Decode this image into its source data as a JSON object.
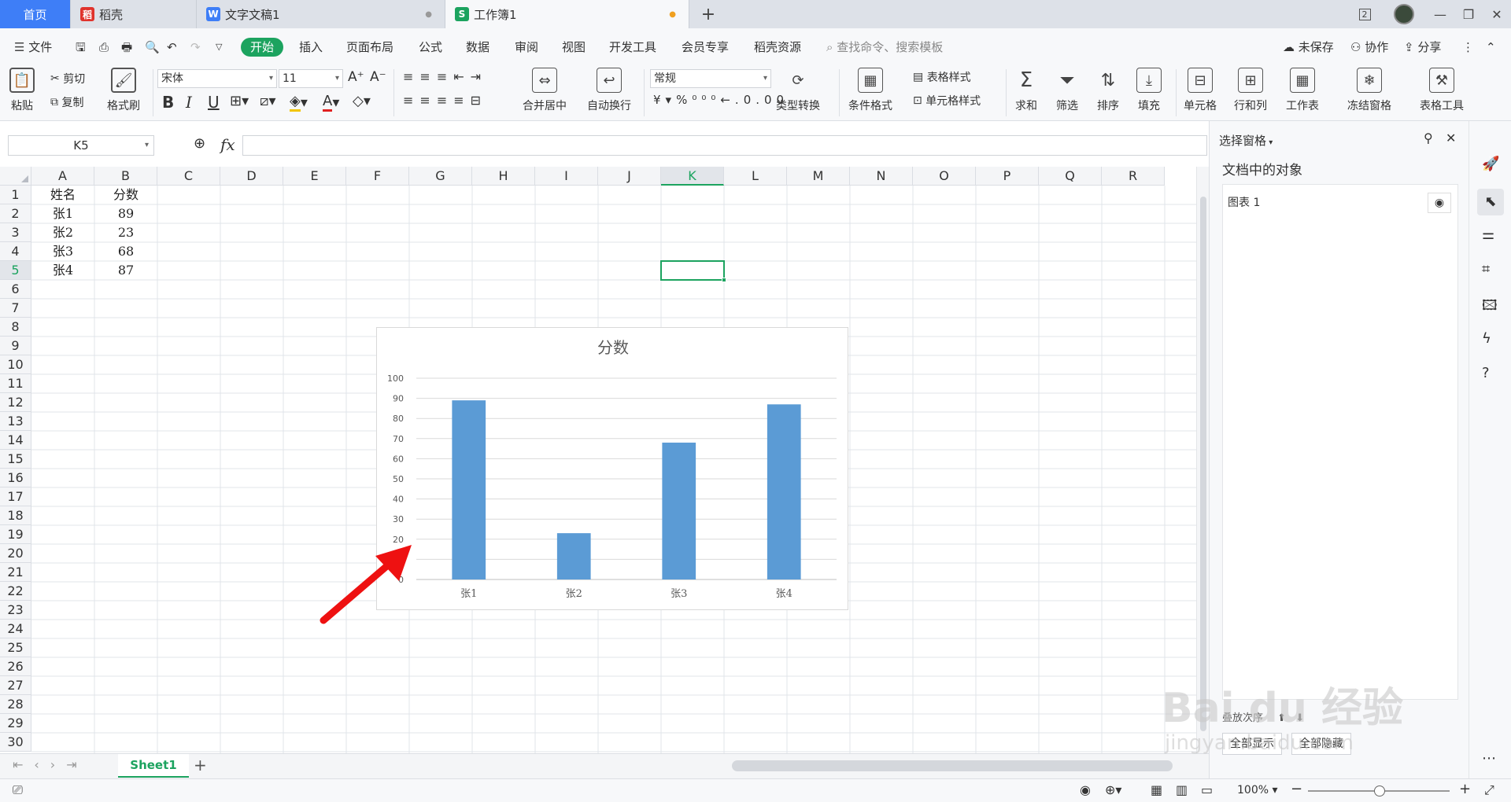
{
  "tabs": [
    {
      "label": "首页"
    },
    {
      "label": "稻壳",
      "icon": "daoke-icon"
    },
    {
      "label": "文字文稿1",
      "icon": "word-icon"
    },
    {
      "label": "工作簿1",
      "icon": "sheet-icon"
    }
  ],
  "window": {
    "badge": "2"
  },
  "menu": {
    "file": "文件",
    "items": [
      "开始",
      "插入",
      "页面布局",
      "公式",
      "数据",
      "审阅",
      "视图",
      "开发工具",
      "会员专享",
      "稻壳资源"
    ],
    "search_placeholder": "查找命令、搜索模板",
    "unsaved": "未保存",
    "collab": "协作",
    "share": "分享"
  },
  "ribbon": {
    "paste": "粘贴",
    "cut": "剪切",
    "copy": "复制",
    "format_painter": "格式刷",
    "font_name": "宋体",
    "font_size": "11",
    "merge_center": "合并居中",
    "wrap_text": "自动换行",
    "number_format": "常规",
    "type_convert": "类型转换",
    "conditional_format": "条件格式",
    "table_style": "表格样式",
    "cell_style": "单元格样式",
    "sum": "求和",
    "filter": "筛选",
    "sort": "排序",
    "fill": "填充",
    "cells": "单元格",
    "rows_cols": "行和列",
    "worksheet": "工作表",
    "freeze": "冻结窗格",
    "table_tools": "表格工具"
  },
  "formula_bar": {
    "name_box": "K5",
    "fx": "fx",
    "value": ""
  },
  "columns": [
    "A",
    "B",
    "C",
    "D",
    "E",
    "F",
    "G",
    "H",
    "I",
    "J",
    "K",
    "L",
    "M",
    "N",
    "O",
    "P",
    "Q",
    "R"
  ],
  "rows": [
    "1",
    "2",
    "3",
    "4",
    "5",
    "6",
    "7",
    "8",
    "9",
    "10",
    "11",
    "12",
    "13",
    "14",
    "15",
    "16",
    "17",
    "18",
    "19",
    "20",
    "21",
    "22",
    "23",
    "24",
    "25",
    "26",
    "27",
    "28",
    "29",
    "30"
  ],
  "cells": [
    {
      "ref": "A1",
      "value": "姓名"
    },
    {
      "ref": "B1",
      "value": "分数"
    },
    {
      "ref": "A2",
      "value": "张1"
    },
    {
      "ref": "B2",
      "value": "89"
    },
    {
      "ref": "A3",
      "value": "张2"
    },
    {
      "ref": "B3",
      "value": "23"
    },
    {
      "ref": "A4",
      "value": "张3"
    },
    {
      "ref": "B4",
      "value": "68"
    },
    {
      "ref": "A5",
      "value": "张4"
    },
    {
      "ref": "B5",
      "value": "87"
    }
  ],
  "selected_cell": "K5",
  "chart_data": {
    "type": "bar",
    "title": "分数",
    "categories": [
      "张1",
      "张2",
      "张3",
      "张4"
    ],
    "values": [
      89,
      23,
      68,
      87
    ],
    "ylim": [
      0,
      100
    ],
    "yticks": [
      0,
      10,
      20,
      30,
      40,
      50,
      60,
      70,
      80,
      90,
      100
    ],
    "grid": true,
    "bar_color": "#5b9bd5"
  },
  "annotation": {
    "arrow_color": "#ee1111"
  },
  "panel": {
    "title": "选择窗格",
    "subtitle": "文档中的对象",
    "objects": [
      {
        "label": "图表 1"
      }
    ],
    "order_label": "叠放次序",
    "show_all": "全部显示",
    "hide_all": "全部隐藏"
  },
  "sheets": [
    {
      "label": "Sheet1"
    }
  ],
  "status": {
    "zoom": "100%"
  },
  "watermark": {
    "text": "Bai du 经验",
    "url": "jingyan.baidu.com"
  },
  "colors": {
    "accent": "#1ca35f",
    "selection": "#1ca35f",
    "tab_home": "#3e7ef7"
  }
}
